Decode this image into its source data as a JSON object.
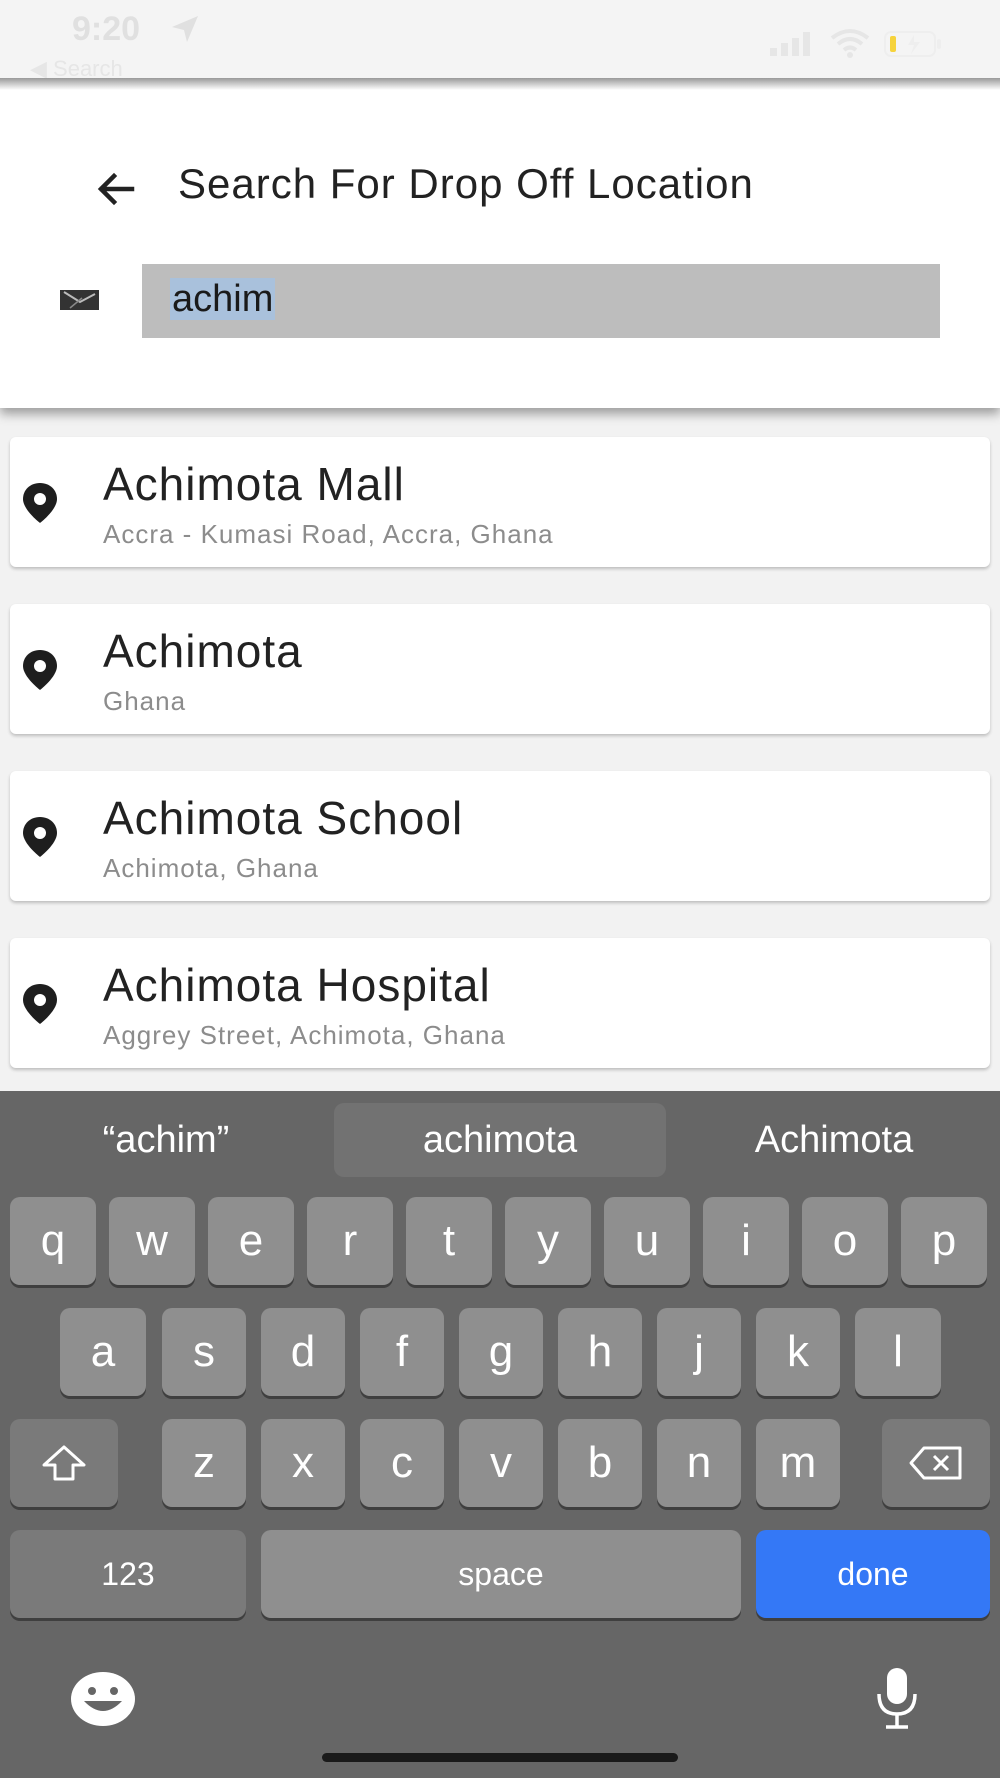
{
  "status_bar": {
    "time": "9:20",
    "back_label": "◀ Search"
  },
  "header": {
    "title": "Search For Drop Off Location",
    "search_value": "achim"
  },
  "results": [
    {
      "name": "Achimota Mall",
      "address": "Accra - Kumasi Road, Accra, Ghana"
    },
    {
      "name": "Achimota",
      "address": "Ghana"
    },
    {
      "name": "Achimota School",
      "address": "Achimota, Ghana"
    },
    {
      "name": "Achimota Hospital",
      "address": "Aggrey Street, Achimota, Ghana"
    }
  ],
  "keyboard": {
    "suggestions": [
      "“achim”",
      "achimota",
      "Achimota"
    ],
    "row1": [
      "q",
      "w",
      "e",
      "r",
      "t",
      "y",
      "u",
      "i",
      "o",
      "p"
    ],
    "row2": [
      "a",
      "s",
      "d",
      "f",
      "g",
      "h",
      "j",
      "k",
      "l"
    ],
    "row3": [
      "z",
      "x",
      "c",
      "v",
      "b",
      "n",
      "m"
    ],
    "numbers_label": "123",
    "space_label": "space",
    "done_label": "done"
  },
  "colors": {
    "done_key": "#3478f6",
    "keyboard_bg": "#666666",
    "selection": "#a9c1dc"
  },
  "icons": [
    "location-arrow-icon",
    "cellular-signal-icon",
    "wifi-icon",
    "battery-icon",
    "back-arrow-icon",
    "map-pin-icon",
    "shift-icon",
    "backspace-icon",
    "emoji-icon",
    "microphone-icon"
  ]
}
